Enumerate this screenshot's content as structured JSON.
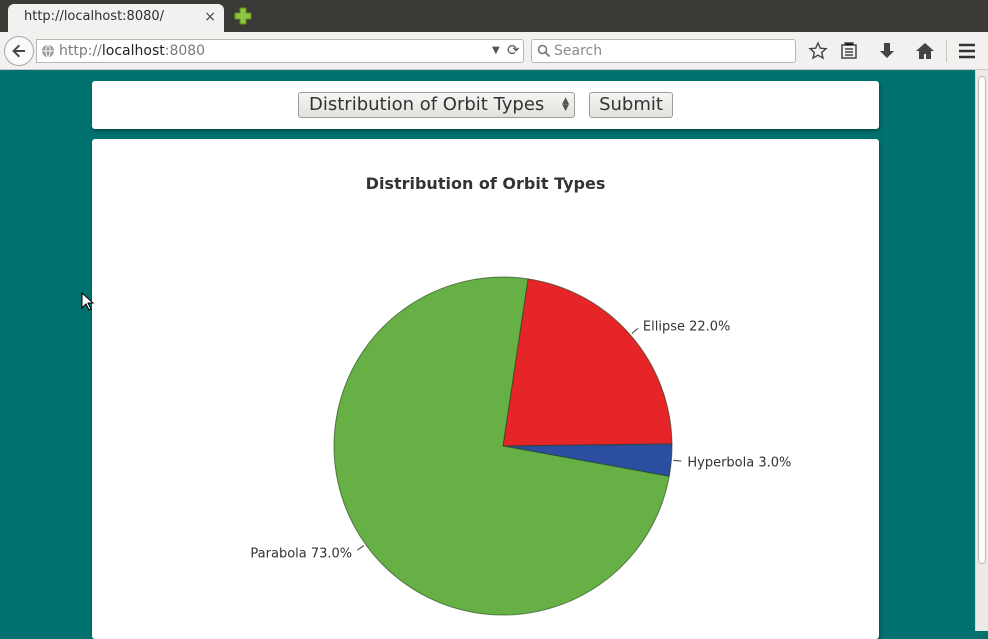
{
  "browser": {
    "tab_title": "http://localhost:8080/",
    "tab_close": "×",
    "url_prefix": "http://",
    "url_host": "localhost",
    "url_port": ":8080",
    "search_placeholder": "Search"
  },
  "controls": {
    "selected_option": "Distribution of Orbit Types",
    "submit_label": "Submit"
  },
  "chart_data": {
    "type": "pie",
    "title": "Distribution of Orbit Types",
    "categories": [
      "Ellipse",
      "Hyperbola",
      "Parabola"
    ],
    "values": [
      22.0,
      3.0,
      73.0
    ],
    "labels": [
      "Ellipse 22.0%",
      "Hyperbola 3.0%",
      "Parabola 73.0%"
    ],
    "colors": [
      "#e52528",
      "#2b4ea0",
      "#66b046"
    ]
  },
  "colors": {
    "page_background": "#00716f",
    "panel_background": "#ffffff"
  }
}
